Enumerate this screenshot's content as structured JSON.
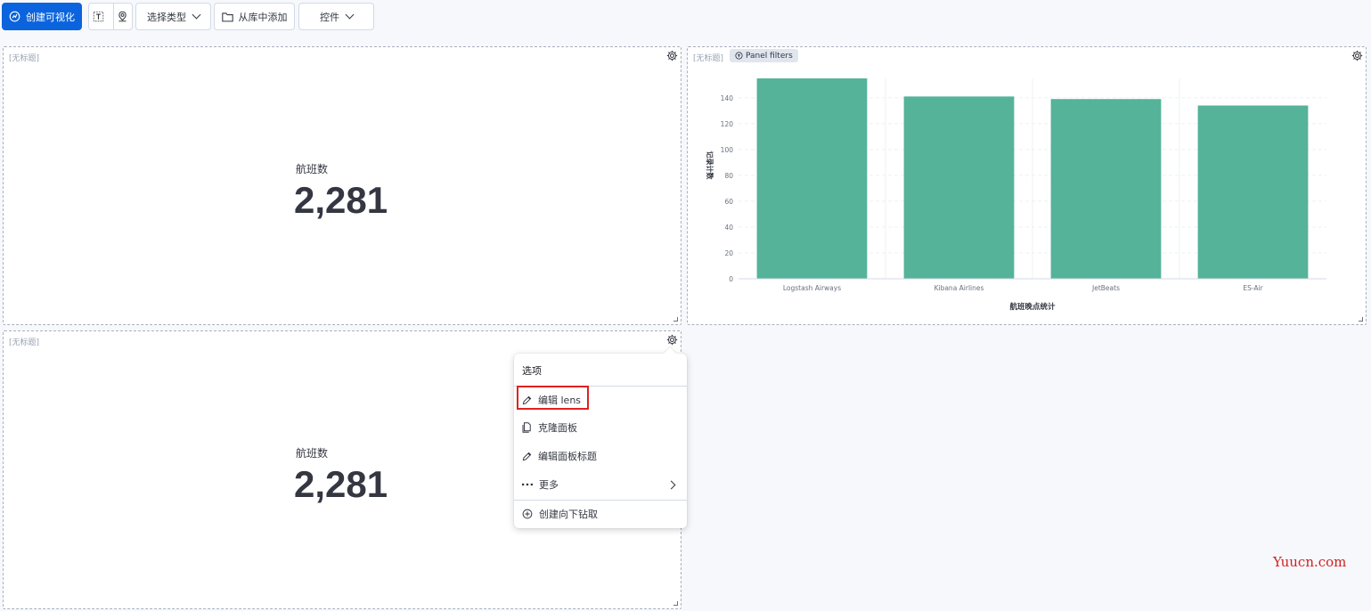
{
  "toolbar": {
    "create_label": "创建可视化",
    "select_type_label": "选择类型",
    "add_from_library_label": "从库中添加",
    "controls_label": "控件",
    "icons": [
      "visualize-icon",
      "text-icon",
      "map-icon",
      "chevron-down-icon",
      "folder-icon"
    ]
  },
  "panels": [
    {
      "title": "[无标题]",
      "metric_label": "航班数",
      "metric_value": "2,281"
    },
    {
      "title": "[无标题]",
      "badge": "Panel filters"
    },
    {
      "title": "[无标题]",
      "metric_label": "航班数",
      "metric_value": "2,281"
    }
  ],
  "menu": {
    "title": "选项",
    "items": [
      {
        "label": "编辑 lens",
        "icon": "pencil-icon"
      },
      {
        "label": "克隆面板",
        "icon": "copy-icon"
      },
      {
        "label": "编辑面板标题",
        "icon": "pencil-icon"
      },
      {
        "label": "更多",
        "icon": "more-icon"
      },
      {
        "label": "创建向下钻取",
        "icon": "plus-circle-icon"
      }
    ]
  },
  "chart_data": {
    "type": "bar",
    "categories": [
      "Logstash Airways",
      "Kibana Airlines",
      "JetBeats",
      "ES-Air"
    ],
    "values": [
      155,
      141,
      139,
      134
    ],
    "xlabel": "航班晚点统计",
    "ylabel": "记录计数",
    "ylim": [
      0,
      155
    ],
    "yticks": [
      0,
      20,
      40,
      60,
      80,
      100,
      120,
      140
    ],
    "color": "#54b399",
    "grid": true
  },
  "watermark": "Yuucn.com",
  "colors": {
    "primary": "#0b64dd",
    "bar": "#54b399",
    "highlight": "#e02020"
  }
}
